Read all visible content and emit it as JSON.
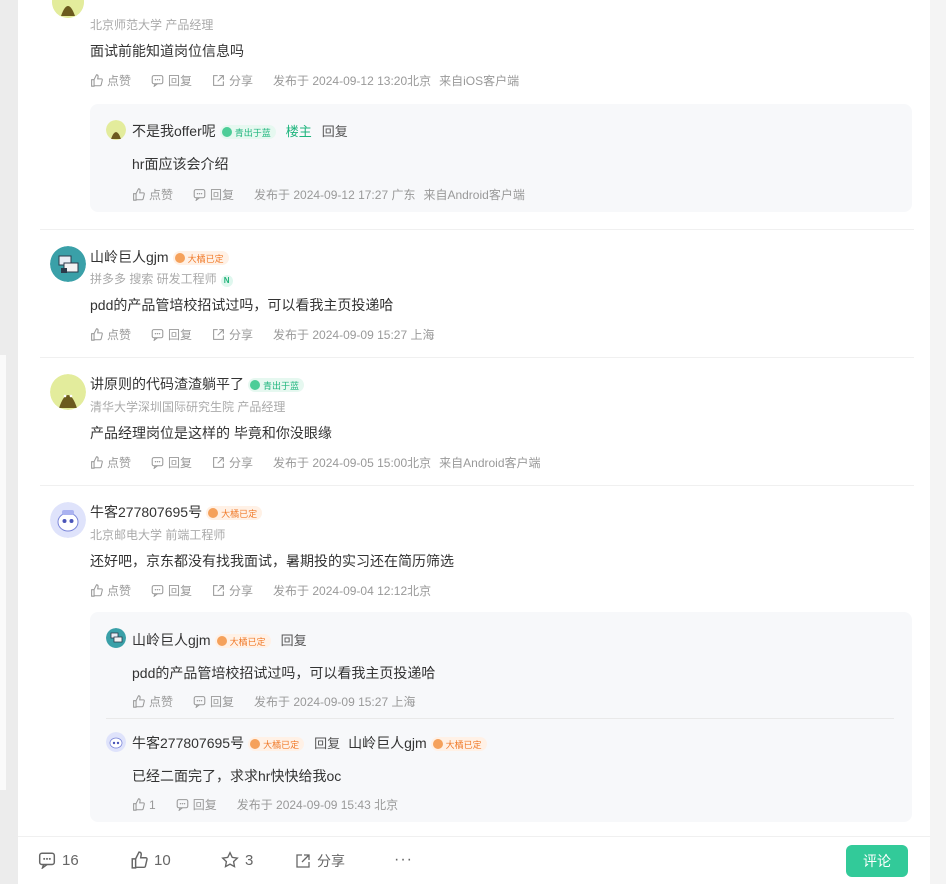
{
  "comments": [
    {
      "meta": "北京师范大学 产品经理",
      "content": "面试前能知道岗位信息吗",
      "like": "点赞",
      "reply": "回复",
      "share": "分享",
      "time": "发布于 2024-09-12 13:20北京",
      "source": "来自iOS客户端",
      "replies": [
        {
          "name": "不是我offer呢",
          "badge": "青出于蓝",
          "owner": "楼主",
          "reply_link": "回复",
          "content": "hr面应该会介绍",
          "like": "点赞",
          "reply": "回复",
          "time": "发布于 2024-09-12 17:27 广东",
          "source": "来自Android客户端"
        }
      ]
    },
    {
      "name": "山岭巨人gjm",
      "badge": "大橘已定",
      "meta": "拼多多 搜索 研发工程师",
      "tag": "N",
      "content": "pdd的产品管培校招试过吗，可以看我主页投递哈",
      "like": "点赞",
      "reply": "回复",
      "share": "分享",
      "time": "发布于 2024-09-09 15:27 上海"
    },
    {
      "name": "讲原则的代码渣渣躺平了",
      "badge": "青出于蓝",
      "meta": "清华大学深圳国际研究生院 产品经理",
      "content": "产品经理岗位是这样的 毕竟和你没眼缘",
      "like": "点赞",
      "reply": "回复",
      "share": "分享",
      "time": "发布于 2024-09-05 15:00北京",
      "source": "来自Android客户端"
    },
    {
      "name": "牛客277807695号",
      "badge": "大橘已定",
      "meta": "北京邮电大学 前端工程师",
      "content": "还好吧，京东都没有找我面试，暑期投的实习还在简历筛选",
      "like": "点赞",
      "reply": "回复",
      "share": "分享",
      "time": "发布于 2024-09-04 12:12北京",
      "replies": [
        {
          "name": "山岭巨人gjm",
          "badge": "大橘已定",
          "reply_link": "回复",
          "content": "pdd的产品管培校招试过吗，可以看我主页投递哈",
          "like": "点赞",
          "reply": "回复",
          "time": "发布于 2024-09-09 15:27 上海"
        },
        {
          "name": "牛客277807695号",
          "badge": "大橘已定",
          "reply_link": "回复",
          "target_name": "山岭巨人gjm",
          "target_badge": "大橘已定",
          "content": "已经二面完了，求求hr快快给我oc",
          "like": "1",
          "reply": "回复",
          "time": "发布于 2024-09-09 15:43 北京"
        }
      ]
    }
  ],
  "bottombar": {
    "comments": "16",
    "likes": "10",
    "stars": "3",
    "share": "分享",
    "more": "···",
    "comment_button": "评论"
  },
  "colors": {
    "accent": "#32ca99",
    "badge_orange": "#f07a2a",
    "badge_green": "#1fb57d"
  }
}
